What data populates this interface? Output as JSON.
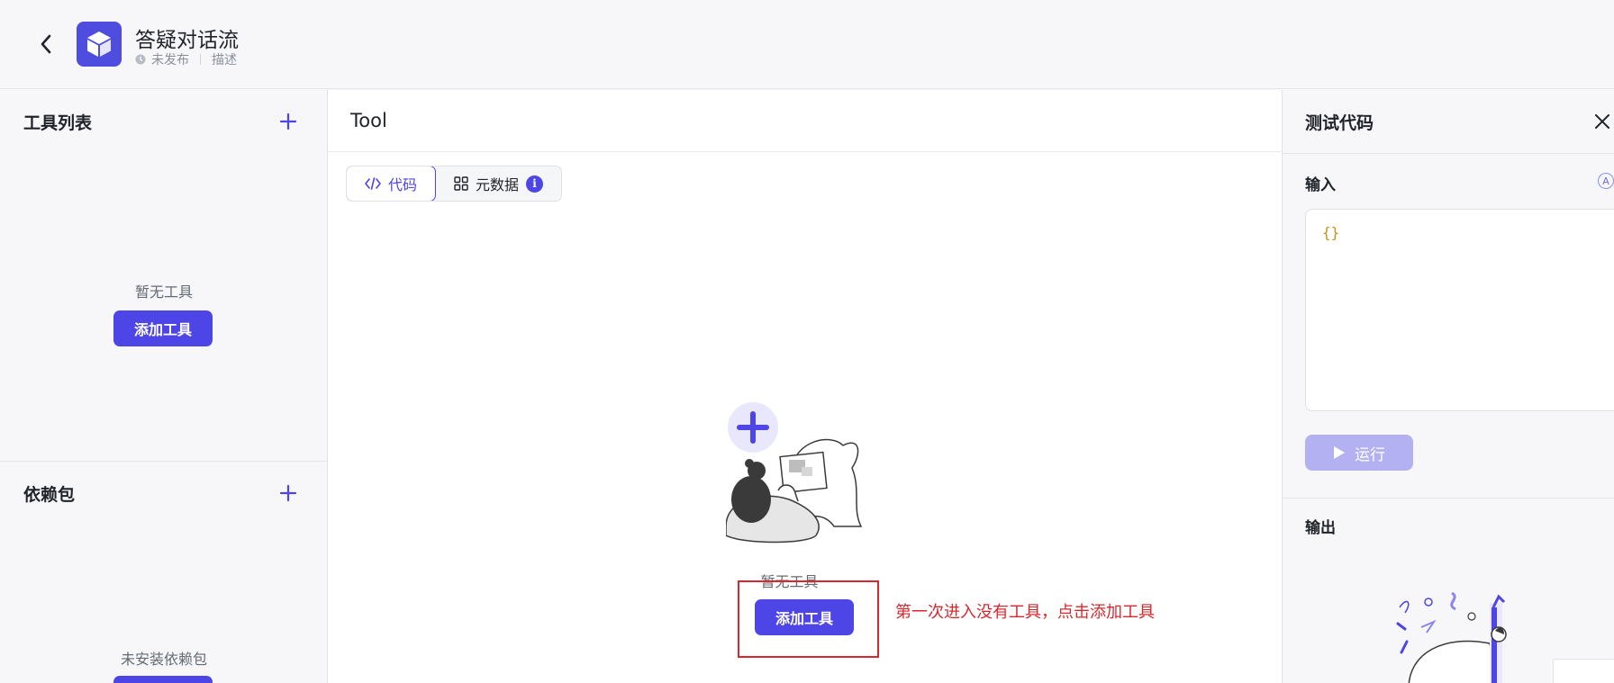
{
  "header": {
    "title": "答疑对话流",
    "status": "未发布",
    "description_link": "描述"
  },
  "left": {
    "tools_title": "工具列表",
    "tools_empty": "暂无工具",
    "tools_add_button": "添加工具",
    "deps_title": "依赖包",
    "deps_empty": "未安装依赖包"
  },
  "center": {
    "title": "Tool",
    "tabs": [
      {
        "label": "代码",
        "icon": "code-icon",
        "active": true
      },
      {
        "label": "元数据",
        "icon": "grid-icon",
        "active": false,
        "badge": "i"
      }
    ],
    "empty_text": "暂无工具",
    "add_button": "添加工具",
    "annotation": "第一次进入没有工具，点击添加工具"
  },
  "right": {
    "title": "测试代码",
    "input_label": "输入",
    "input_value": "{}",
    "format_icon_letter": "A",
    "run_button": "运行",
    "output_label": "输出"
  },
  "colors": {
    "accent": "#4d45e6",
    "annotation_red": "#d9272e",
    "disabled_button": "#b4b1f3",
    "code_brace": "#c29418"
  }
}
